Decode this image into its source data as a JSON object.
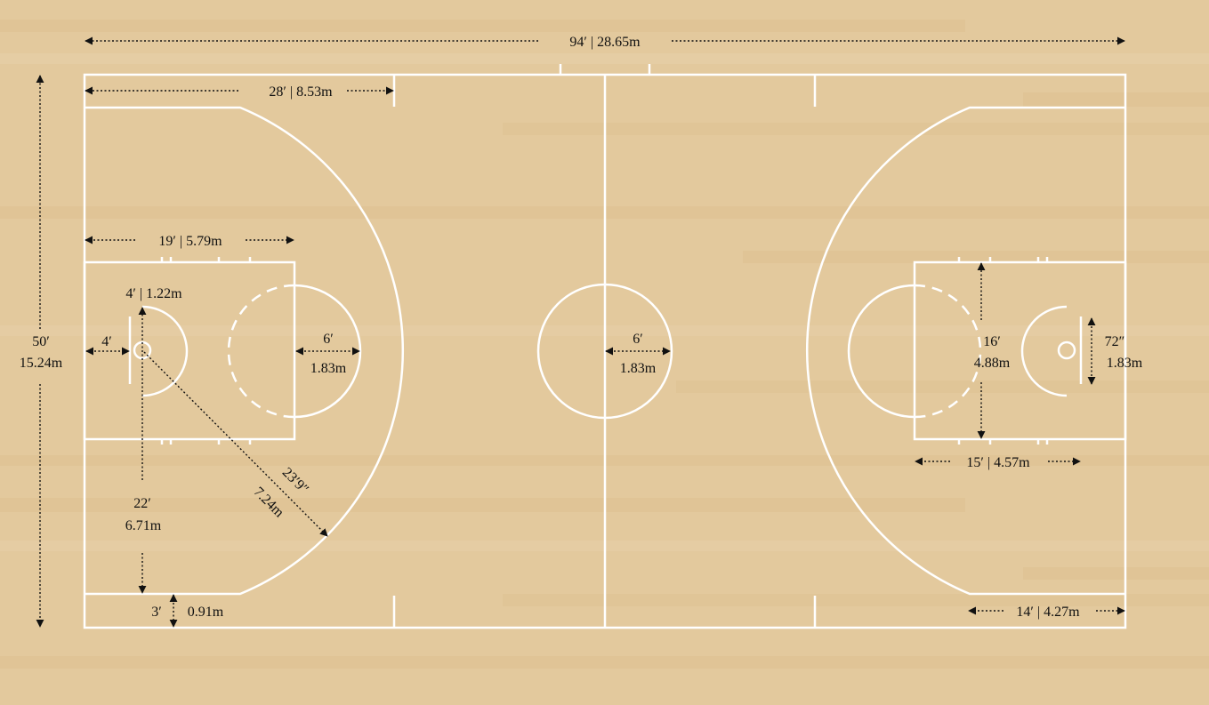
{
  "colors": {
    "floor": "#e3c99d",
    "floor_light": "#e6cfa6",
    "floor_dark": "#ddc291",
    "lines": "#ffffff",
    "dimensions": "#111111"
  },
  "labels": {
    "court_length": "94′ | 28.65m",
    "court_width_ft": "50′",
    "court_width_m": "15.24m",
    "backcourt_28": "28′ | 8.53m",
    "lane_length": "19′ | 5.79m",
    "backboard_offset": "4′ | 1.22m",
    "basket_offset": "4′",
    "ft_circle_ft": "6′",
    "ft_circle_m": "1.83m",
    "center_circle_ft": "6′",
    "center_circle_m": "1.83m",
    "three_arc_ft": "23′9″",
    "three_arc_m": "7.24m",
    "three_corner_ft": "22′",
    "three_corner_m": "6.71m",
    "corner_gap_ft": "3′",
    "corner_gap_m": "0.91m",
    "lane_width_ft": "16′",
    "lane_width_m": "4.88m",
    "backboard_ft": "72″",
    "backboard_m": "1.83m",
    "ft_distance": "15′ | 4.57m",
    "three_straight": "14′ | 4.27m"
  }
}
